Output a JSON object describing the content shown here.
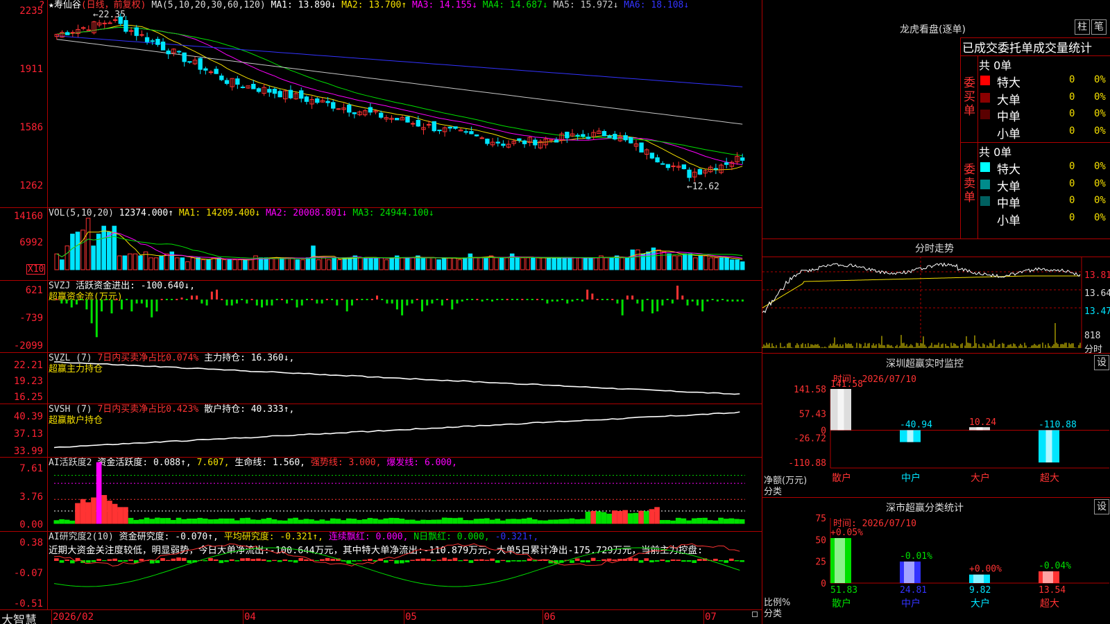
{
  "stock": {
    "name": "★寿仙谷",
    "period": "(日线，前复权)",
    "ma_params": "MA(5,10,20,30,60,120)",
    "ma": [
      {
        "label": "MA1: 13.890↓",
        "color": "#ffffff"
      },
      {
        "label": "MA2: 13.700↑",
        "color": "#f5e000"
      },
      {
        "label": "MA3: 14.155↓",
        "color": "#ff00ff"
      },
      {
        "label": "MA4: 14.687↓",
        "color": "#00e000"
      },
      {
        "label": "MA5: 15.972↓",
        "color": "#c8c8c8"
      },
      {
        "label": "MA6: 18.108↓",
        "color": "#3333ff"
      }
    ],
    "high_mark": "←22.35",
    "low_mark": "←12.62",
    "y_labels": [
      "2235",
      "1911",
      "1586",
      "1262"
    ],
    "top_marker": "?"
  },
  "vol": {
    "title": "VOL(5,10,20)",
    "value": "12374.000↑",
    "ma": [
      {
        "label": "MA1: 14209.400↓",
        "color": "#f5e000"
      },
      {
        "label": "MA2: 20008.801↓",
        "color": "#ff00ff"
      },
      {
        "label": "MA3: 24944.100↓",
        "color": "#00e000"
      }
    ],
    "y_labels": [
      "14160",
      "6992"
    ],
    "unit": "X10",
    "values": [
      40,
      25,
      60,
      90,
      95,
      100,
      130,
      60,
      90,
      110,
      95,
      110,
      35,
      35,
      40,
      40,
      35,
      45,
      30,
      30,
      35,
      40,
      45,
      30,
      30,
      20,
      30,
      30,
      25,
      25,
      30,
      30,
      25,
      25,
      25,
      25,
      25,
      25,
      35,
      30,
      30,
      30,
      30,
      30,
      30,
      30,
      25,
      25,
      30,
      60,
      25,
      30,
      25,
      30,
      25,
      30,
      30,
      35,
      30,
      30,
      30,
      30,
      30,
      25,
      30,
      35,
      30,
      30,
      30,
      35,
      30,
      30,
      30,
      25,
      30,
      30,
      30,
      25,
      30,
      40,
      30,
      30,
      30,
      35,
      30,
      30,
      30,
      40,
      30,
      30,
      30,
      30,
      30,
      30,
      30,
      30,
      30,
      30,
      30,
      30,
      30,
      30,
      30,
      30,
      35,
      30,
      30,
      35,
      30,
      30,
      50,
      50,
      40,
      45,
      55,
      50,
      45,
      40,
      35,
      35,
      40,
      40,
      30,
      35,
      35,
      30,
      30,
      30,
      30,
      25,
      25,
      20
    ],
    "ups": [
      1,
      0,
      1,
      0,
      0,
      1,
      1,
      0,
      0,
      0,
      0,
      0,
      1,
      0,
      1,
      1,
      0,
      1,
      1,
      1,
      0,
      1,
      0,
      1,
      0,
      1,
      1,
      0,
      1,
      0,
      1,
      0,
      1,
      0,
      1,
      1,
      0,
      1,
      1,
      0,
      0,
      1,
      1,
      0,
      1,
      1,
      0,
      1,
      0,
      0,
      1,
      1,
      1,
      0,
      1,
      0,
      0,
      0,
      1,
      0,
      0,
      0,
      1,
      1,
      0,
      0,
      1,
      0,
      1,
      0,
      0,
      1,
      1,
      0,
      0,
      1,
      1,
      1,
      0,
      0,
      1,
      1,
      0,
      1,
      1,
      0,
      1,
      0,
      0,
      1,
      1,
      0,
      1,
      1,
      0,
      0,
      0,
      0,
      0,
      1,
      1,
      0,
      0,
      1,
      1,
      1,
      0,
      0,
      1,
      0,
      0,
      1,
      0,
      0,
      0,
      1,
      1,
      0,
      1,
      1,
      0,
      0,
      1,
      0,
      1,
      1,
      1,
      0,
      0,
      0,
      0,
      0
    ]
  },
  "svzj": {
    "title": "SVZJ",
    "label": "活跃资金进出: -100.640↓,",
    "subtitle": "超赢资金流(万元)",
    "y_labels": [
      "621",
      "-739",
      "-2099"
    ],
    "values": [
      0,
      -200,
      -200,
      -400,
      -250,
      0,
      -500,
      -1200,
      -1900,
      -600,
      0,
      -700,
      0,
      -500,
      0,
      -600,
      -200,
      -200,
      -400,
      -900,
      -600,
      0,
      0,
      0,
      0,
      100,
      0,
      200,
      200,
      -200,
      -300,
      400,
      500,
      0,
      -300,
      -300,
      -200,
      0,
      -200,
      0,
      -300,
      -400,
      -300,
      -300,
      0,
      0,
      -200,
      0,
      -400,
      -300,
      0,
      0,
      -200,
      -200,
      0,
      0,
      -300,
      0,
      -600,
      -300,
      0,
      0,
      0,
      0,
      200,
      0,
      -200,
      -200,
      -500,
      -800,
      -300,
      -200,
      0,
      -600,
      -300,
      -200,
      0,
      -300,
      0,
      -500,
      -200,
      -100,
      0,
      0,
      0,
      -100,
      0,
      -100,
      0,
      0,
      0,
      0,
      0,
      0,
      0,
      0,
      0,
      0,
      -200,
      -100,
      -100,
      0,
      -200,
      -100,
      0,
      -100,
      500,
      300,
      0,
      0,
      0,
      0,
      -200,
      -800,
      200,
      200,
      -200,
      -600,
      0,
      -700,
      -600,
      -300,
      0,
      -200,
      700,
      200,
      -300,
      -100,
      -300,
      -600,
      -100,
      0,
      -100,
      0,
      -100,
      -100,
      -100,
      -100
    ],
    "ups_threshold": 0
  },
  "svzl": {
    "title": "SVZL (7)",
    "label_a": "7日内买卖净占比0.074%",
    "label_b": "主力持仓: 16.360↓,",
    "subtitle": "超赢主力持仓",
    "y_labels": [
      "22.21",
      "19.23",
      "16.25"
    ]
  },
  "svsh": {
    "title": "SVSH (7)",
    "label_a": "7日内买卖净占比0.423%",
    "label_b": "散户持仓: 40.333↑,",
    "subtitle": "超赢散户持仓",
    "y_labels": [
      "40.39",
      "37.13",
      "33.99"
    ]
  },
  "ai_act": {
    "title": "AI活跃度2",
    "label_a": "资金活跃度: 0.088↑,",
    "label_b": "7.607,",
    "label_c": "生命线: 1.560,",
    "label_d": "强势线: 3.000,",
    "label_e": "爆发线: 6.000,",
    "y_labels": [
      "7.61",
      "3.76",
      "0.00"
    ]
  },
  "ai_res": {
    "title": "AI研究度2(10)",
    "label_a": "资金研究度: -0.070↑,",
    "label_b": "平均研究度: -0.321↑,",
    "label_c": "连续飘红: 0.000,",
    "label_d": "N日飘红: 0.000,",
    "label_e": "-0.321↑,",
    "comment": "近期大资金关注度较低，明显弱势，今日大单净流出:-100.644万元，其中特大单净流出:-110.879万元，大单5日累计净出-175.729万元，当前主力控盘:",
    "y_labels": [
      "0.38",
      "-0.07",
      "-0.51"
    ]
  },
  "xaxis": {
    "brand": "大智慧",
    "labels": [
      "2026/02",
      "04",
      "05",
      "06",
      "07"
    ]
  },
  "right": {
    "longhu_title": "龙虎看盘(逐单)",
    "btn_zhu": "柱",
    "btn_bi": "笔",
    "stats_title": "已成交委托单成交量统计",
    "buy": {
      "side": "委买单",
      "total": "共 0单",
      "rows": [
        {
          "name": "特大",
          "vol": "0",
          "pct": "0%",
          "color": "#ff0000"
        },
        {
          "name": "大单",
          "vol": "0",
          "pct": "0%",
          "color": "#8b0000"
        },
        {
          "name": "中单",
          "vol": "0",
          "pct": "0%",
          "color": "#5a0000"
        },
        {
          "name": "小单",
          "vol": "0",
          "pct": "0%",
          "color": ""
        }
      ]
    },
    "sell": {
      "side": "委卖单",
      "total": "共 0单",
      "rows": [
        {
          "name": "特大",
          "vol": "0",
          "pct": "0%",
          "color": "#00ffff"
        },
        {
          "name": "大单",
          "vol": "0",
          "pct": "0%",
          "color": "#008b8b"
        },
        {
          "name": "中单",
          "vol": "0",
          "pct": "0%",
          "color": "#006060"
        },
        {
          "name": "小单",
          "vol": "0",
          "pct": "0%",
          "color": ""
        }
      ]
    },
    "intraday": {
      "title": "分时走势",
      "labels": [
        "13.81",
        "13.64",
        "13.47",
        "818"
      ],
      "unit": "分时"
    },
    "sz_monitor": {
      "title": "深圳超赢实时监控",
      "settings": "设",
      "time": "时间: 2026/07/10",
      "y_labels": [
        "141.58",
        "57.43",
        "0",
        "-26.72",
        "-110.88"
      ],
      "y_caption_a": "净额(万元)",
      "y_caption_b": "分类",
      "bars": [
        {
          "cat": "散户",
          "value": 141.58,
          "label": "141.58"
        },
        {
          "cat": "中户",
          "value": -40.94,
          "label": "-40.94"
        },
        {
          "cat": "大户",
          "value": 10.24,
          "label": "10.24"
        },
        {
          "cat": "超大",
          "value": -110.88,
          "label": "-110.88"
        }
      ]
    },
    "sz_class": {
      "title": "深市超赢分类统计",
      "settings": "设",
      "time": "时间: 2026/07/10",
      "y_labels": [
        "75",
        "50",
        "25",
        "0"
      ],
      "y_caption_a": "比例%",
      "y_caption_b": "分类",
      "bars": [
        {
          "cat": "散户",
          "value": 51.83,
          "label": "51.83",
          "change": "+0.05%"
        },
        {
          "cat": "中户",
          "value": 24.81,
          "label": "24.81",
          "change": "-0.01%"
        },
        {
          "cat": "大户",
          "value": 9.82,
          "label": "9.82",
          "change": "+0.00%"
        },
        {
          "cat": "超大",
          "value": 13.54,
          "label": "13.54",
          "change": "-0.04%"
        }
      ]
    }
  },
  "colors": {
    "up": "#ff3333",
    "down": "#00e5ff",
    "grid": "#b00000",
    "axis_text": "#ff3333"
  }
}
